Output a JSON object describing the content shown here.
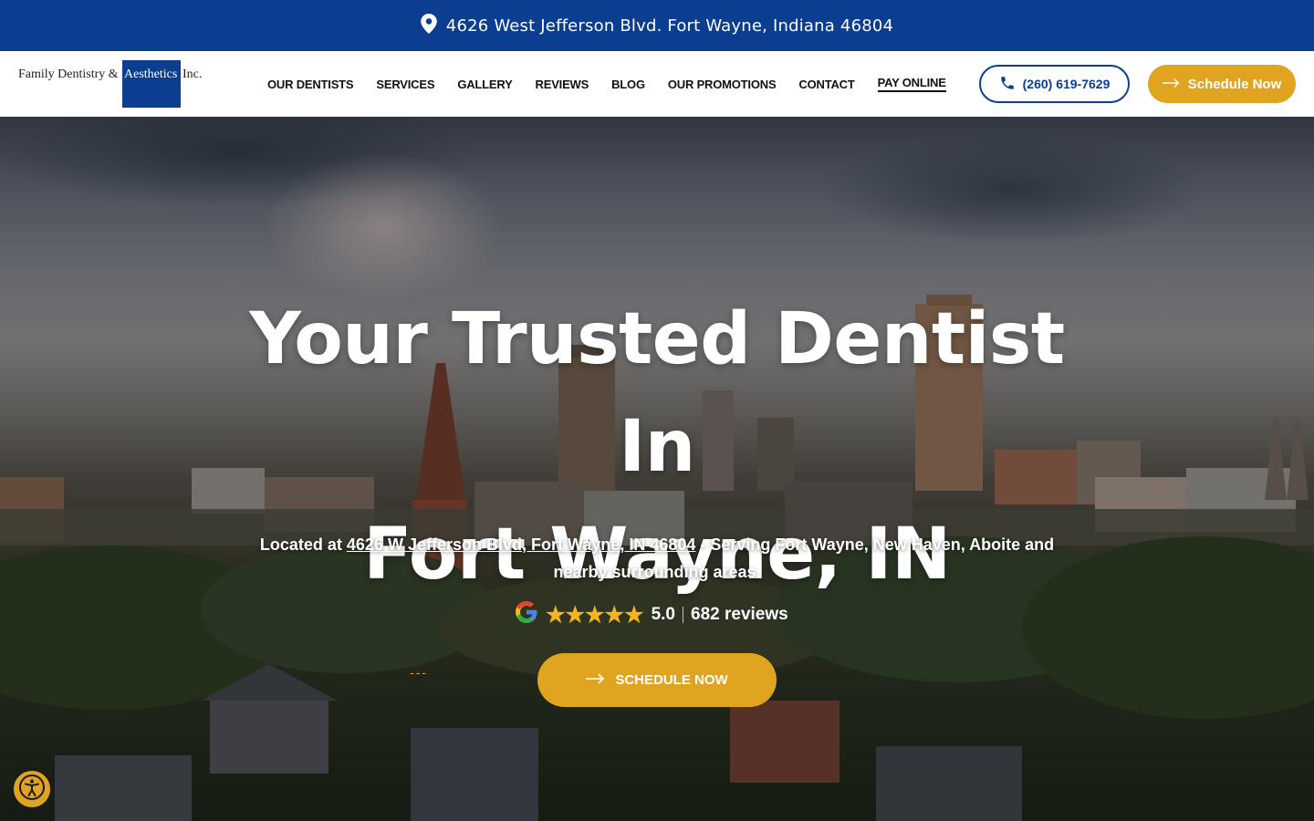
{
  "topbar": {
    "address": "4626 West Jefferson Blvd. Fort Wayne, Indiana 46804",
    "icon": "map-pin-icon"
  },
  "header": {
    "logo": {
      "part_a": "Family Dentistry &",
      "part_b": "Aesthetics",
      "part_c": "Inc."
    },
    "nav": [
      {
        "label": "OUR DENTISTS"
      },
      {
        "label": "SERVICES"
      },
      {
        "label": "GALLERY"
      },
      {
        "label": "REVIEWS"
      },
      {
        "label": "BLOG"
      },
      {
        "label": "OUR PROMOTIONS"
      },
      {
        "label": "CONTACT"
      },
      {
        "label": "PAY ONLINE"
      }
    ],
    "phone": "(260) 619-7629",
    "schedule_label": "Schedule Now"
  },
  "hero": {
    "headline_line1": "Your Trusted Dentist In",
    "headline_line2": "Fort Wayne, IN",
    "sub_prefix": "Located at",
    "sub_address": "4626 W Jefferson Blvd, Fort Wayne, IN 46804",
    "sub_suffix": "- Serving Fort Wayne, New Haven, Aboite and nearby surrounding areas.",
    "rating_value": "5.0",
    "rating_stars": "★★★★★",
    "reviews": "682 reviews",
    "cta_label": "SCHEDULE NOW",
    "dashes": "---"
  },
  "colors": {
    "brand_blue": "#0b3d91",
    "accent_gold": "#e0a421"
  }
}
